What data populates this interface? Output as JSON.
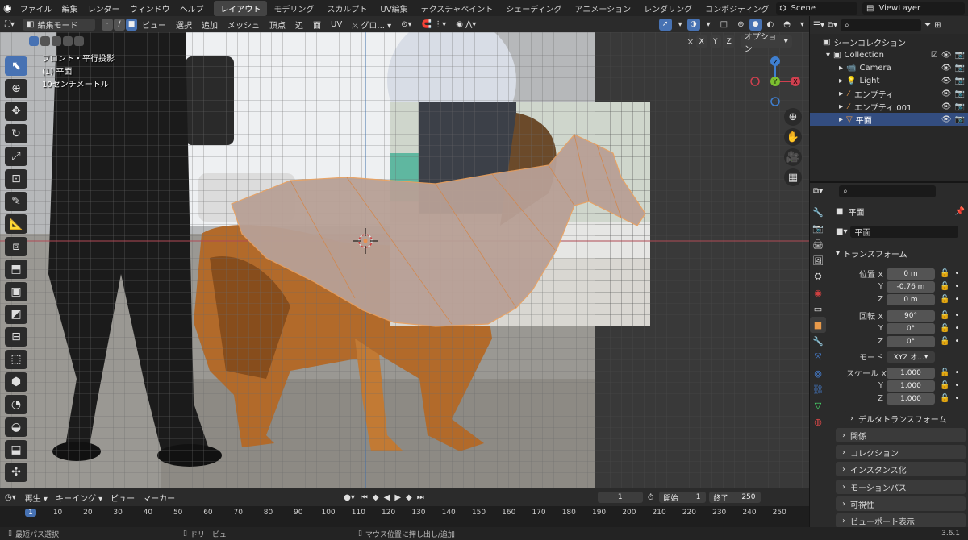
{
  "app": {
    "menus": [
      "ファイル",
      "編集",
      "レンダー",
      "ウィンドウ",
      "ヘルプ"
    ],
    "workspaces": [
      "レイアウト",
      "モデリング",
      "スカルプト",
      "UV編集",
      "テクスチャペイント",
      "シェーディング",
      "アニメーション",
      "レンダリング",
      "コンポジティング"
    ],
    "active_workspace": "レイアウト",
    "scene": "Scene",
    "view_layer": "ViewLayer"
  },
  "viewport_header": {
    "mode": "編集モード",
    "menus": [
      "ビュー",
      "選択",
      "追加",
      "メッシュ",
      "頂点",
      "辺",
      "面",
      "UV"
    ],
    "orientation": "グロ...",
    "options": "オプション",
    "axes": [
      "X",
      "Y",
      "Z"
    ]
  },
  "viewport_overlay": {
    "line1": "フロント・平行投影",
    "line2": "(1) 平面",
    "line3": "10センチメートル"
  },
  "gizmo": {
    "z": "Z",
    "y": "Y",
    "x": "X"
  },
  "outliner": {
    "search_placeholder": "",
    "rows": [
      {
        "label": "シーンコレクション",
        "icon": "collection-icon"
      },
      {
        "label": "Collection",
        "icon": "collection-icon"
      },
      {
        "label": "Camera",
        "icon": "camera-icon"
      },
      {
        "label": "Light",
        "icon": "light-icon"
      },
      {
        "label": "エンプティ",
        "icon": "empty-icon"
      },
      {
        "label": "エンプティ.001",
        "icon": "empty-icon"
      },
      {
        "label": "平面",
        "icon": "mesh-icon"
      }
    ]
  },
  "properties": {
    "object_name": "平面",
    "data_name": "平面",
    "transform_title": "トランスフォーム",
    "location_label": "位置",
    "rotation_label": "回転",
    "mode_label": "モード",
    "scale_label": "スケール",
    "loc": [
      "0 m",
      "-0.76 m",
      "0 m"
    ],
    "rot": [
      "90°",
      "0°",
      "0°"
    ],
    "mode": "XYZ オ...",
    "scale": [
      "1.000",
      "1.000",
      "1.000"
    ],
    "axis": [
      "X",
      "Y",
      "Z"
    ],
    "sections": [
      "デルタトランスフォーム",
      "関係",
      "コレクション",
      "インスタンス化",
      "モーションパス",
      "可視性",
      "ビューポート表示"
    ]
  },
  "timeline": {
    "menus": [
      "再生",
      "キーイング",
      "ビュー",
      "マーカー"
    ],
    "current": "1",
    "start_label": "開始",
    "start": "1",
    "end_label": "終了",
    "end": "250",
    "ticks": [
      "1",
      "10",
      "20",
      "30",
      "40",
      "50",
      "60",
      "70",
      "80",
      "90",
      "100",
      "110",
      "120",
      "130",
      "140",
      "150",
      "160",
      "170",
      "180",
      "190",
      "200",
      "210",
      "220",
      "230",
      "240",
      "250"
    ]
  },
  "status": {
    "left": "最短パス選択",
    "mid": "ドリービュー",
    "right": "マウス位置に押し出し/追加",
    "version": "3.6.1"
  },
  "colors": {
    "accent": "#4772b3",
    "mesh_face": "#b8a096",
    "mesh_edge": "#e8a060"
  }
}
